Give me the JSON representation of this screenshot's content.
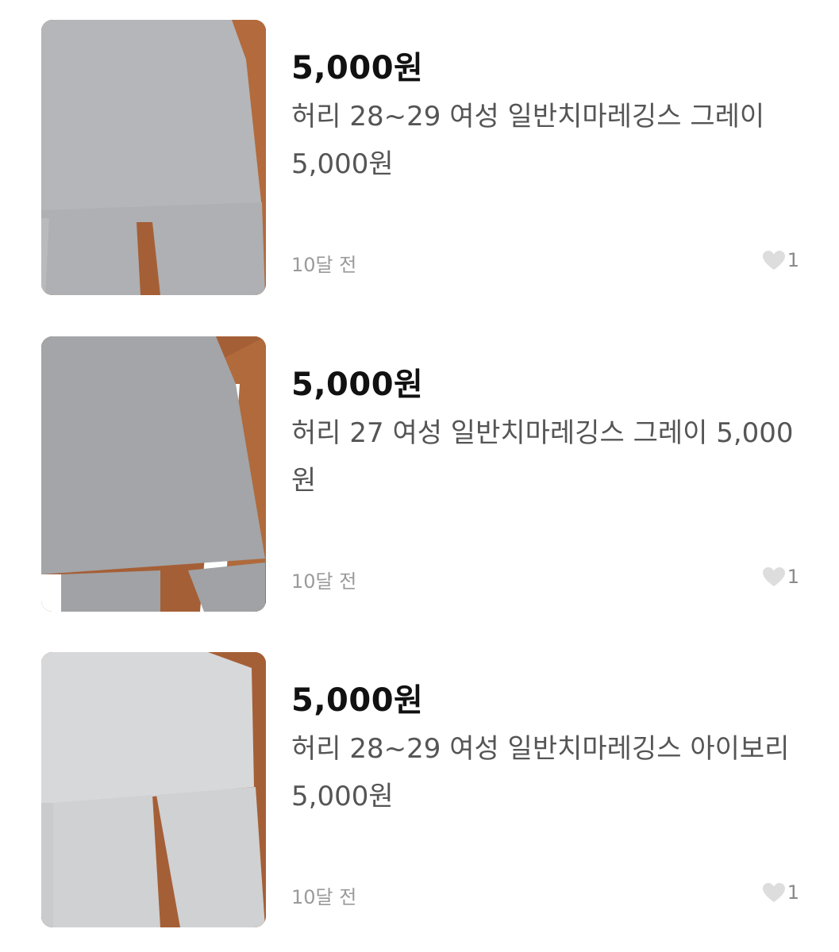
{
  "items": [
    {
      "price_title": "5,000원",
      "description": "허리 28~29 여성 일반치마레깅스 그레이 5,000원",
      "time": "10달 전",
      "like_count": "1"
    },
    {
      "price_title": "5,000원",
      "description": "허리 27 여성 일반치마레깅스 그레이 5,000원",
      "time": "10달 전",
      "like_count": "1"
    },
    {
      "price_title": "5,000원",
      "description": "허리 28~29 여성 일반치마레깅스 아이보리 5,000원",
      "time": "10달 전",
      "like_count": "1"
    }
  ],
  "icons": {
    "like": "heart-icon"
  },
  "colors": {
    "price": "#111111",
    "description": "#555555",
    "meta": "#9a9a9a",
    "heart": "#dddddd"
  }
}
